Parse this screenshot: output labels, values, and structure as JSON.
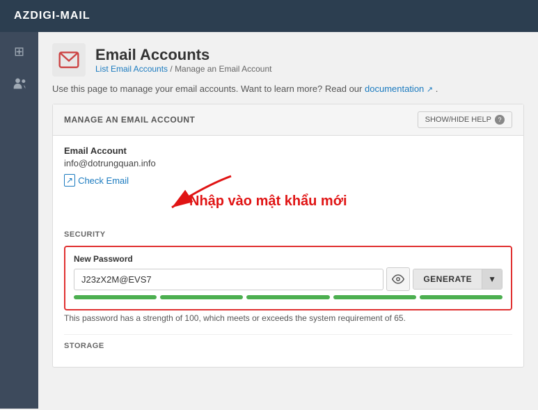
{
  "app": {
    "title": "AZDIGI-MAIL"
  },
  "sidebar": {
    "icons": [
      {
        "name": "grid-icon",
        "symbol": "⊞"
      },
      {
        "name": "users-icon",
        "symbol": "👥"
      }
    ]
  },
  "page": {
    "title": "Email Accounts",
    "breadcrumb_link": "List Email Accounts",
    "breadcrumb_separator": "/",
    "breadcrumb_current": "Manage an Email Account",
    "description": "Use this page to manage your email accounts. Want to learn more? Read our",
    "doc_link": "documentation",
    "doc_suffix": "."
  },
  "card": {
    "header": "MANAGE AN EMAIL ACCOUNT",
    "show_hide_btn": "SHOW/HIDE HELP",
    "help_icon": "?"
  },
  "account": {
    "label": "Email Account",
    "value": "info@dotrungquan.info",
    "check_email_label": "Check Email"
  },
  "annotation": {
    "text": "Nhập vào mật khẩu mới"
  },
  "security": {
    "section_label": "SECURITY",
    "field_label": "New Password",
    "password_value": "J23zX2M@EVS7",
    "generate_label": "GENERATE",
    "strength_text": "This password has a strength of 100, which meets or exceeds the system requirement of 65.",
    "bars": [
      1,
      1,
      1,
      1,
      1
    ]
  },
  "storage": {
    "section_label": "STORAGE"
  }
}
